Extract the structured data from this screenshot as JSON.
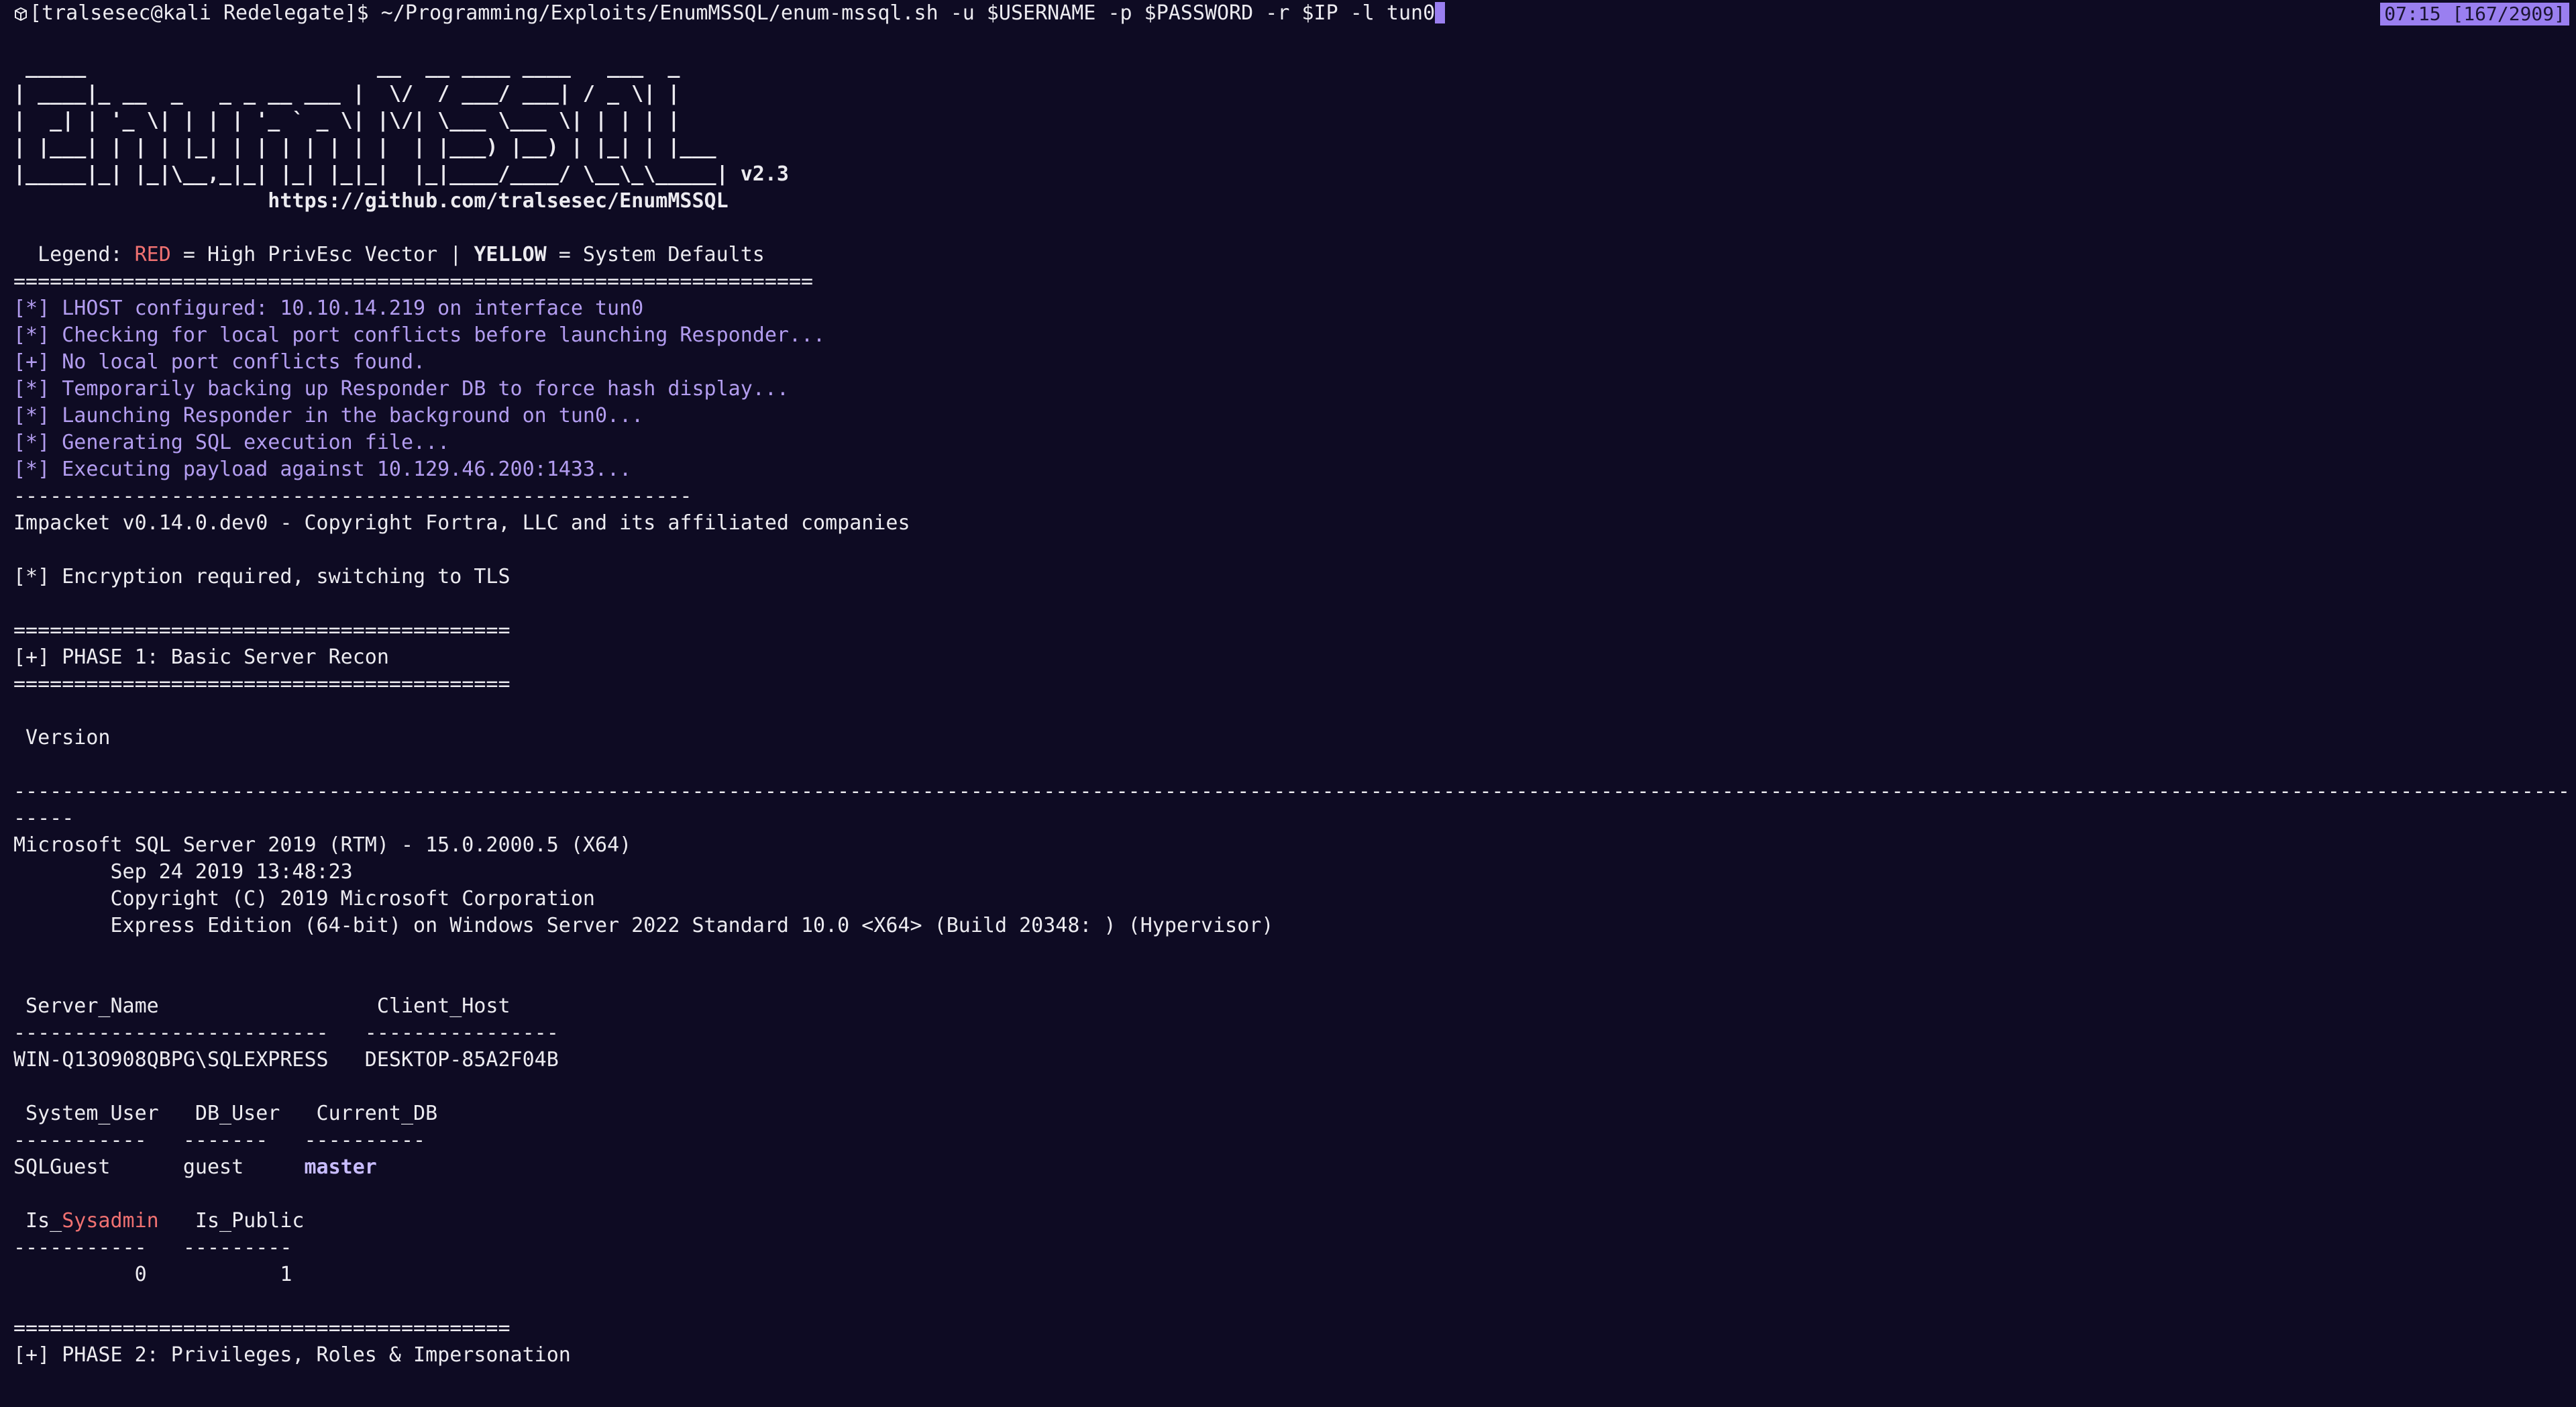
{
  "colors": {
    "background": "#0e0b23",
    "text": "#ecebf0",
    "info": "#b39df0",
    "red": "#f07171",
    "cursor": "#9a7ff0"
  },
  "prompt": {
    "user_host": "[tralsesec@kali Redelegate]$",
    "command": " ~/Programming/Exploits/EnumMSSQL/enum-mssql.sh -u $USERNAME -p $PASSWORD -r $IP -l tun0"
  },
  "status": {
    "text": "07:15 [167/2909]"
  },
  "banner": {
    "ascii": [
      " _____                        __  __ ____ ____   ___  _     ",
      "| ____|_ __  _   _ _ __ ___ |  \\/  / ___/ ___| / _ \\| |    ",
      "|  _| | '_ \\| | | | '_ ` _ \\| |\\/| \\___ \\___ \\| | | | |    ",
      "| |___| | | | |_| | | | | | | |  | |___) |__) | |_| | |___ ",
      "|_____|_| |_|\\__,_|_| |_| |_|_|  |_|____/____/ \\__\\_\\_____|"
    ],
    "version": " v2.3",
    "url": "                     https://github.com/tralsesec/EnumMSSQL",
    "legend_prefix": "  Legend: ",
    "legend_red": "RED",
    "legend_mid": " = High PrivEsc Vector | ",
    "legend_yellow": "YELLOW",
    "legend_suffix": " = System Defaults"
  },
  "separators": {
    "long_eq": "==================================================================",
    "dashes": "--------------------------------------------------------",
    "eq": "=========================================",
    "full_dash": "-----------------------------------------------------------------------------------------------------------------------------------------------------------------------------------------------------------------------------",
    "dash_tail": "-----"
  },
  "info_lines": [
    "[*] LHOST configured: 10.10.14.219 on interface tun0",
    "[*] Checking for local port conflicts before launching Responder...",
    "[+] No local port conflicts found.",
    "[*] Temporarily backing up Responder DB to force hash display...",
    "[*] Launching Responder in the background on tun0...",
    "[*] Generating SQL execution file...",
    "[*] Executing payload against 10.129.46.200:1433..."
  ],
  "impacket": "Impacket v0.14.0.dev0 - Copyright Fortra, LLC and its affiliated companies",
  "tls": "[*] Encryption required, switching to TLS",
  "phase1": "[+] PHASE 1: Basic Server Recon",
  "version_header": " Version",
  "version_lines": [
    "Microsoft SQL Server 2019 (RTM) - 15.0.2000.5 (X64)",
    "        Sep 24 2019 13:48:23",
    "        Copyright (C) 2019 Microsoft Corporation",
    "        Express Edition (64-bit) on Windows Server 2022 Standard 10.0 <X64> (Build 20348: ) (Hypervisor)"
  ],
  "server_table": {
    "header": " Server_Name                  Client_Host",
    "rule": "--------------------------   ----------------",
    "row": "WIN-Q13O908QBPG\\SQLEXPRESS   DESKTOP-85A2F04B"
  },
  "user_table": {
    "header": " System_User   DB_User   Current_DB",
    "rule": "-----------   -------   ----------",
    "row_prefix": "SQLGuest      guest     ",
    "row_db": "master"
  },
  "sysadmin_table": {
    "header_prefix": " Is_",
    "header_red": "Sysadmin",
    "header_suffix": "   Is_Public",
    "rule": "-----------   ---------",
    "row": "          0           1"
  },
  "phase2": "[+] PHASE 2: Privileges, Roles & Impersonation"
}
